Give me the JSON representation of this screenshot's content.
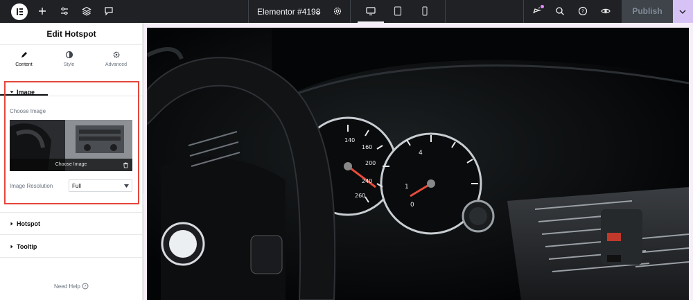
{
  "topbar": {
    "document_title": "Elementor #4198",
    "publish_label": "Publish",
    "icons": [
      "elementor-logo-icon",
      "add-icon",
      "settings-sliders-icon",
      "layers-icon",
      "comments-icon",
      "chevron-down-icon",
      "gear-icon",
      "desktop-icon",
      "tablet-icon",
      "mobile-icon",
      "whats-new-icon",
      "search-icon",
      "help-icon",
      "preview-eye-icon",
      "chevron-down-icon"
    ]
  },
  "panel": {
    "title": "Edit Hotspot",
    "tabs": [
      {
        "label": "Content",
        "icon": "pencil-icon",
        "active": true
      },
      {
        "label": "Style",
        "icon": "half-circle-icon",
        "active": false
      },
      {
        "label": "Advanced",
        "icon": "gear-icon",
        "active": false
      }
    ],
    "image_section": {
      "title": "Image",
      "choose_label": "Choose Image",
      "choose_button": "Choose Image",
      "resolution_label": "Image Resolution",
      "resolution_value": "Full"
    },
    "hotspot_section": {
      "title": "Hotspot"
    },
    "tooltip_section": {
      "title": "Tooltip"
    },
    "need_help": "Need Help"
  },
  "colors": {
    "topbar_bg": "#1f2124",
    "accent": "#e08aff",
    "highlight_border": "#e5463b",
    "publish_menu_bg": "#d7c2f5"
  }
}
